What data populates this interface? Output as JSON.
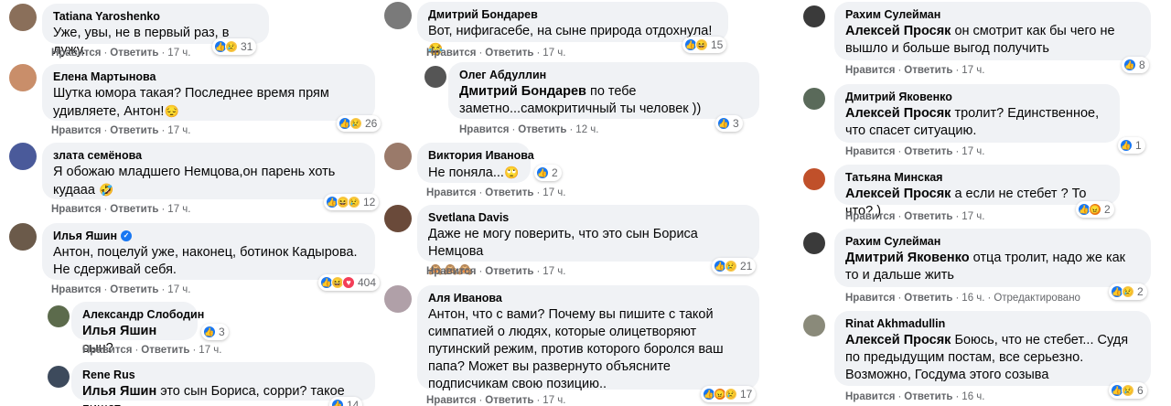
{
  "common": {
    "like": "Нравится",
    "reply": "Ответить",
    "dot": "·"
  },
  "col1": [
    {
      "author": "Tatiana Yaroshenko",
      "text": "Уже, увы, не в первый раз, в лужу.",
      "time": "17 ч.",
      "reactions": [
        "like",
        "sad"
      ],
      "count": "31",
      "avatar_color": "#8a6f5a"
    },
    {
      "author": "Елена Мартынова",
      "text": "Шутка юмора такая? Последнее время прям удивляете, Антон!",
      "emoji": "😔",
      "time": "17 ч.",
      "reactions": [
        "like",
        "sad"
      ],
      "count": "26",
      "avatar_color": "#c98e6a"
    },
    {
      "author": "злата семёнова",
      "text": "Я обожаю младшего Немцова,он парень хоть кудааа",
      "emoji": "🤣",
      "time": "17 ч.",
      "reactions": [
        "like",
        "haha",
        "sad"
      ],
      "count": "12",
      "avatar_color": "#4a5a9a"
    },
    {
      "author": "Илья Яшин",
      "verified": true,
      "text": "Антон, поцелуй уже, наконец, ботинок Кадырова. Не сдерживай себя.",
      "time": "17 ч.",
      "reactions": [
        "like",
        "haha",
        "love"
      ],
      "count": "404",
      "avatar_color": "#6b5a4a"
    },
    {
      "author": "Александр Слободин",
      "mention": "Илья Яшин",
      "text": "сын?",
      "time": "17 ч.",
      "reactions": [
        "like"
      ],
      "count": "3",
      "avatar_color": "#5c6b4c"
    },
    {
      "author": "Rene Rus",
      "mention": "Илья Яшин",
      "text": "это сын Бориса, сорри? такое пишет",
      "reactions": [
        "like"
      ],
      "count": "14",
      "avatar_color": "#3d4a5c"
    }
  ],
  "col2": [
    {
      "author": "Дмитрий Бондарев",
      "text": "Вот, нифигасебе, на сыне природа отдохнула!",
      "emoji": "😂",
      "time": "17 ч.",
      "reactions": [
        "like",
        "haha"
      ],
      "count": "15",
      "avatar_color": "#7a7a7a"
    },
    {
      "author": "Олег Абдуллин",
      "mention": "Дмитрий Бондарев",
      "text": "по тебе заметно...самокритичный ты человек ))",
      "time": "12 ч.",
      "reactions": [
        "like"
      ],
      "count": "3",
      "avatar_color": "#555555"
    },
    {
      "author": "Виктория Иванова",
      "text": "Не поняла...",
      "emoji": "🙄",
      "time": "17 ч.",
      "reactions": [
        "like"
      ],
      "count": "2",
      "avatar_color": "#9a7a6a"
    },
    {
      "author": "Svetlana Davis",
      "text": "Даже не могу поверить, что это сын Бориса Немцова",
      "emoji": "🙈🙈🙈",
      "time": "17 ч.",
      "reactions": [
        "like",
        "sad"
      ],
      "count": "21",
      "avatar_color": "#6a4a3a"
    },
    {
      "author": "Аля Иванова",
      "text": "Антон, что с вами? Почему вы пишите с такой симпатией о людях, которые олицетворяют путинский режим, против которого боролся ваш папа? Может вы развернуто объясните подписчикам свою позицию..",
      "time": "17 ч.",
      "reactions": [
        "like",
        "angry",
        "sad"
      ],
      "count": "17",
      "avatar_color": "#b0a0a8"
    }
  ],
  "col3": [
    {
      "author": "Рахим Сулейман",
      "mention": "Алексей Просяк",
      "text": "он смотрит как бы чего не вышло и больше выгод получить",
      "time": "17 ч.",
      "reactions": [
        "like"
      ],
      "count": "8",
      "avatar_color": "#3a3a3a"
    },
    {
      "author": "Дмитрий Яковенко",
      "mention": "Алексей Просяк",
      "text": "тролит? Единственное, что спасет ситуацию.",
      "time": "17 ч.",
      "reactions": [
        "like"
      ],
      "count": "1",
      "avatar_color": "#5a6a5a"
    },
    {
      "author": "Татьяна Минская",
      "mention": "Алексей Просяк",
      "text": "а если не стебет ? То что? )",
      "time": "17 ч.",
      "reactions": [
        "like",
        "angry"
      ],
      "count": "2",
      "avatar_color": "#c0502a"
    },
    {
      "author": "Рахим Сулейман",
      "mention": "Дмитрий Яковенко",
      "text": "отца тролит, надо же как то и дальше жить",
      "time": "16 ч.",
      "edited": "Отредактировано",
      "reactions": [
        "like",
        "sad"
      ],
      "count": "2",
      "avatar_color": "#3a3a3a"
    },
    {
      "author": "Rinat Akhmadullin",
      "mention": "Алексей Просяк",
      "text": "Боюсь, что не стебет... Судя по предыдущим постам, все серьезно. Возможно, Госдума этого созыва",
      "time": "16 ч.",
      "reactions": [
        "like",
        "sad"
      ],
      "count": "6",
      "avatar_color": "#8a8a7a"
    }
  ]
}
